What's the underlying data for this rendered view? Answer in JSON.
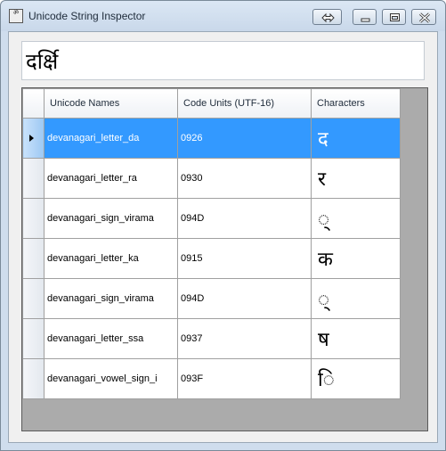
{
  "window": {
    "title": "Unicode String Inspector",
    "icon": "app-icon"
  },
  "input": {
    "value": "दर्क्षि"
  },
  "grid": {
    "columns": [
      "Unicode Names",
      "Code Units (UTF-16)",
      "Characters"
    ],
    "selected_row": 0,
    "rows": [
      {
        "name": "devanagari_letter_da",
        "code": "0926",
        "char": "द"
      },
      {
        "name": "devanagari_letter_ra",
        "code": "0930",
        "char": "र"
      },
      {
        "name": "devanagari_sign_virama",
        "code": "094D",
        "char": "◌्"
      },
      {
        "name": "devanagari_letter_ka",
        "code": "0915",
        "char": "क"
      },
      {
        "name": "devanagari_sign_virama",
        "code": "094D",
        "char": "◌्"
      },
      {
        "name": "devanagari_letter_ssa",
        "code": "0937",
        "char": "ष"
      },
      {
        "name": "devanagari_vowel_sign_i",
        "code": "093F",
        "char": "ि"
      }
    ]
  },
  "colors": {
    "selection": "#3399ff",
    "grid_background": "#ababab"
  }
}
